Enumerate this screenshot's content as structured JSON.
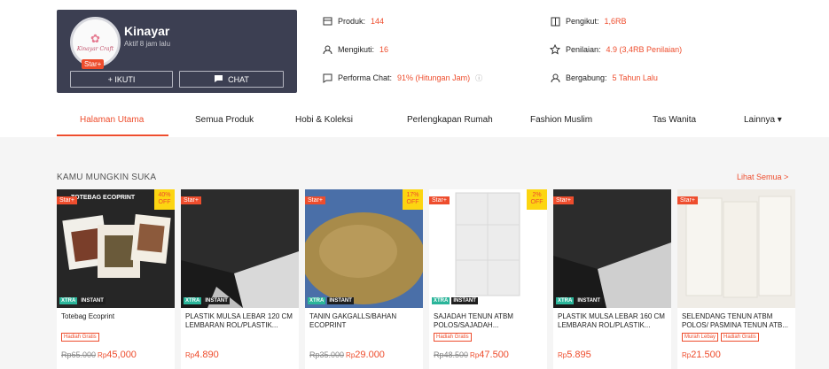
{
  "shop": {
    "name": "Kinayar",
    "active": "Aktif 8 jam lalu",
    "logo_text": "Kinayar Craft",
    "badge": "Star+",
    "follow_label": "+ IKUTI",
    "chat_label": "CHAT"
  },
  "stats": {
    "products_label": "Produk:",
    "products_value": "144",
    "following_label": "Mengikuti:",
    "following_value": "16",
    "chat_label": "Performa Chat:",
    "chat_value": "91% (Hitungan Jam)",
    "followers_label": "Pengikut:",
    "followers_value": "1,6RB",
    "rating_label": "Penilaian:",
    "rating_value": "4.9 (3,4RB Penilaian)",
    "joined_label": "Bergabung:",
    "joined_value": "5 Tahun Lalu"
  },
  "tabs": [
    {
      "label": "Halaman Utama"
    },
    {
      "label": "Semua Produk"
    },
    {
      "label": "Hobi & Koleksi"
    },
    {
      "label": "Perlengkapan Rumah"
    },
    {
      "label": "Fashion Muslim"
    },
    {
      "label": "Tas Wanita"
    },
    {
      "label": "Lainnya ▾"
    }
  ],
  "section": {
    "title": "KAMU MUNGKIN SUKA",
    "see_all": "Lihat Semua >"
  },
  "products": [
    {
      "name": "Totebag Ecoprint",
      "tags": [
        "Hadiah Gratis"
      ],
      "old_price": "Rp65.000",
      "currency": "Rp",
      "price": "45,000",
      "discount": "40%",
      "badge": "Star+",
      "image_caption": "TOTEBAG ECOPRINT"
    },
    {
      "name": "PLASTIK MULSA LEBAR 120 CM LEMBARAN ROL/PLASTIK...",
      "tags": [],
      "old_price": "",
      "currency": "Rp",
      "price": "4.890",
      "discount": "",
      "badge": "Star+"
    },
    {
      "name": "TANIN GAKGALLS/BAHAN ECOPRINT",
      "tags": [],
      "old_price": "Rp35.000",
      "currency": "Rp",
      "price": "29.000",
      "discount": "17%",
      "badge": "Star+"
    },
    {
      "name": "SAJADAH TENUN ATBM POLOS/SAJADAH...",
      "tags": [
        "Hadiah Gratis"
      ],
      "old_price": "Rp48.500",
      "currency": "Rp",
      "price": "47.500",
      "discount": "2%",
      "badge": "Star+"
    },
    {
      "name": "PLASTIK MULSA LEBAR 160 CM LEMBARAN ROL/PLASTIK...",
      "tags": [],
      "old_price": "",
      "currency": "Rp",
      "price": "5.895",
      "discount": "",
      "badge": "Star+"
    },
    {
      "name": "SELENDANG TENUN ATBM POLOS/ PASMINA TENUN ATB...",
      "tags": [
        "Murah Lebay",
        "Hadiah Gratis"
      ],
      "old_price": "",
      "currency": "Rp",
      "price": "21.500",
      "discount": "",
      "badge": "Star+"
    }
  ],
  "promo": {
    "xtra_label": "XTRA",
    "instant_label": "INSTANT"
  },
  "colors": {
    "accent": "#ee4d2d",
    "shop_card_bg": "#3c3f52",
    "section_bg": "#f5f5f5"
  }
}
